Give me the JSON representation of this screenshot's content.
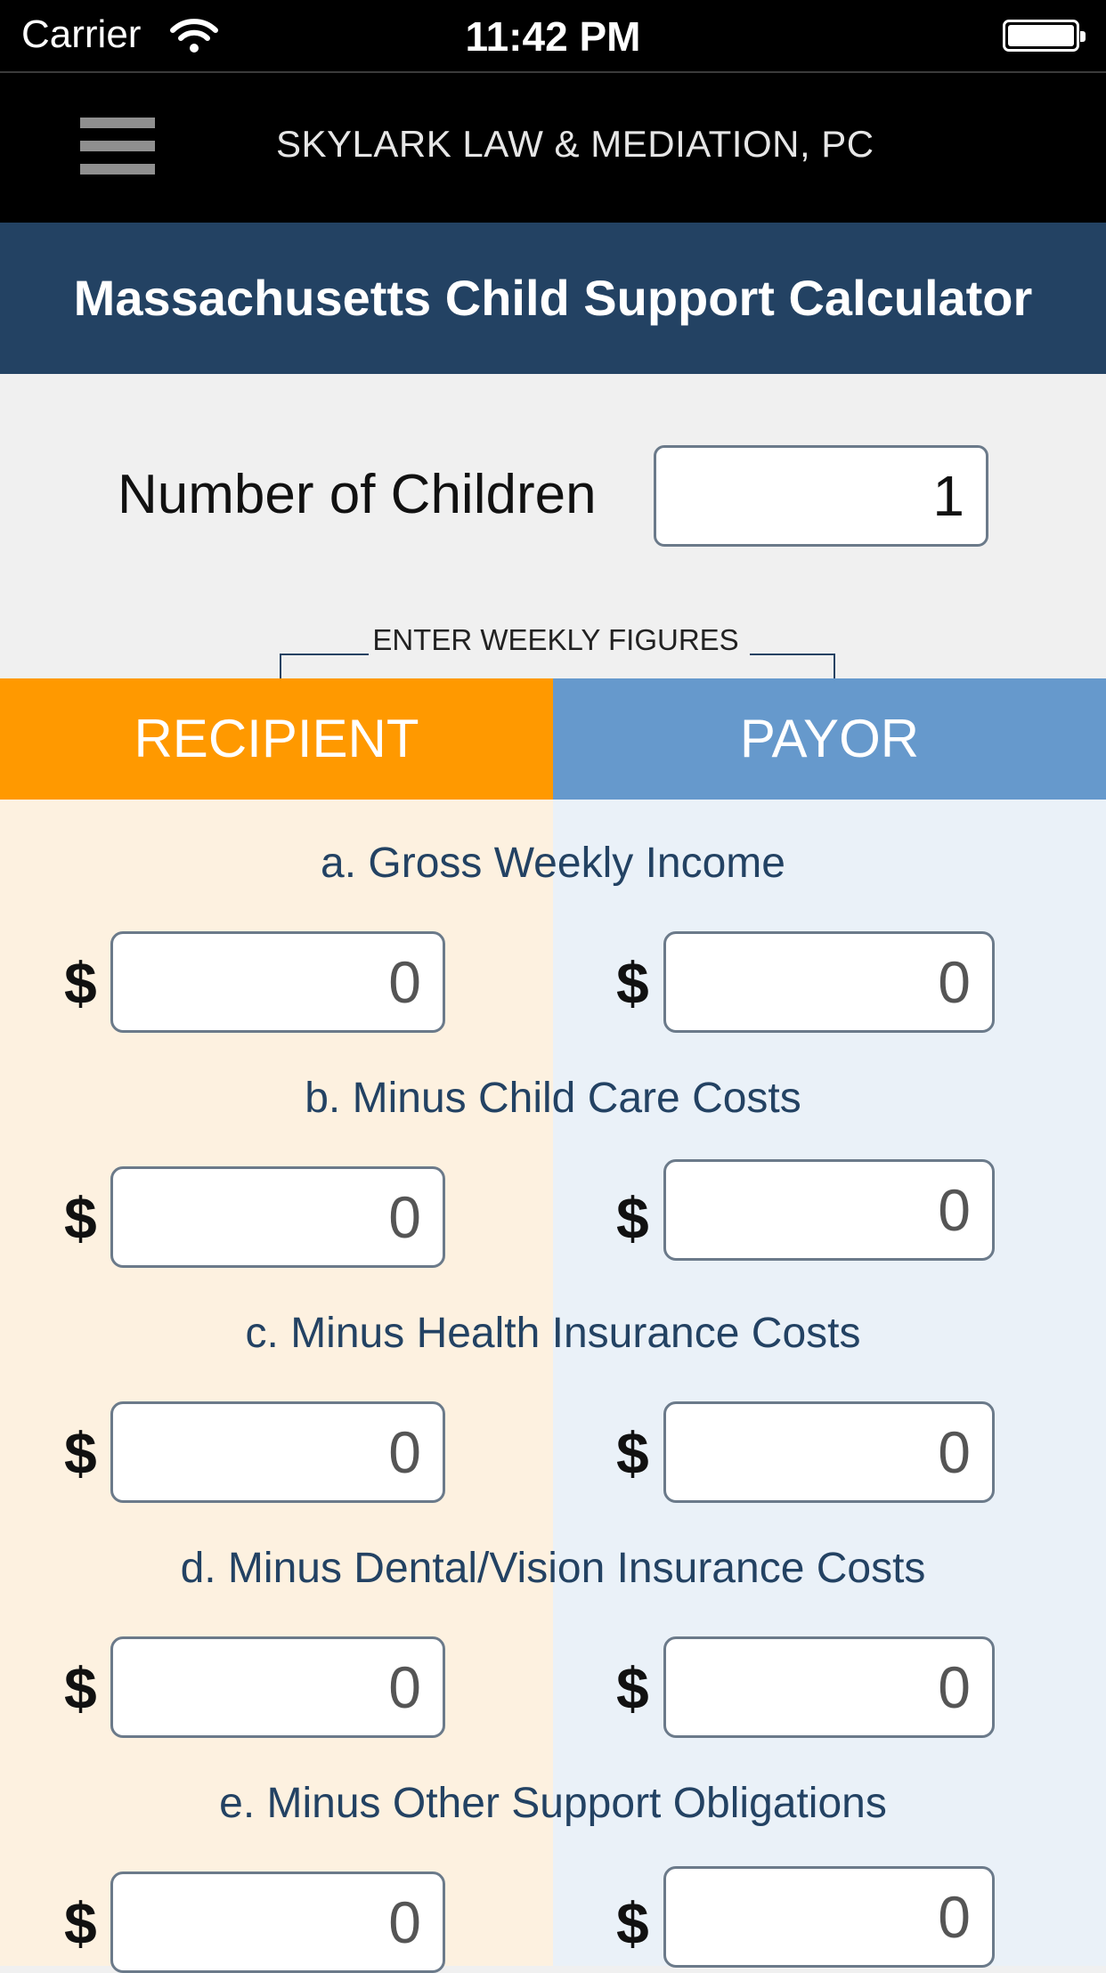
{
  "status_bar": {
    "carrier": "Carrier",
    "time": "11:42 PM"
  },
  "navbar": {
    "brand": "SKYLARK LAW & MEDIATION, PC",
    "menu_icon": "hamburger-menu-icon"
  },
  "header": {
    "title": "Massachusetts Child Support Calculator"
  },
  "children": {
    "label": "Number of Children",
    "value": "1"
  },
  "weekly_note": "ENTER WEEKLY FIGURES",
  "tabs": {
    "recipient": "RECIPIENT",
    "payor": "PAYOR"
  },
  "currency_symbol": "$",
  "fields": [
    {
      "label": "a. Gross Weekly Income",
      "recipient": "0",
      "payor": "0"
    },
    {
      "label": "b. Minus Child Care Costs",
      "recipient": "0",
      "payor": "0"
    },
    {
      "label": "c. Minus Health Insurance Costs",
      "recipient": "0",
      "payor": "0"
    },
    {
      "label": "d. Minus Dental/Vision Insurance Costs",
      "recipient": "0",
      "payor": "0"
    },
    {
      "label": "e. Minus Other Support Obligations",
      "recipient": "0",
      "payor": "0"
    }
  ],
  "colors": {
    "header_bg": "#234263",
    "recipient_accent": "#ff9900",
    "payor_accent": "#6699cc",
    "recipient_panel": "#fdf1e0",
    "payor_panel": "#eaf1f8"
  }
}
